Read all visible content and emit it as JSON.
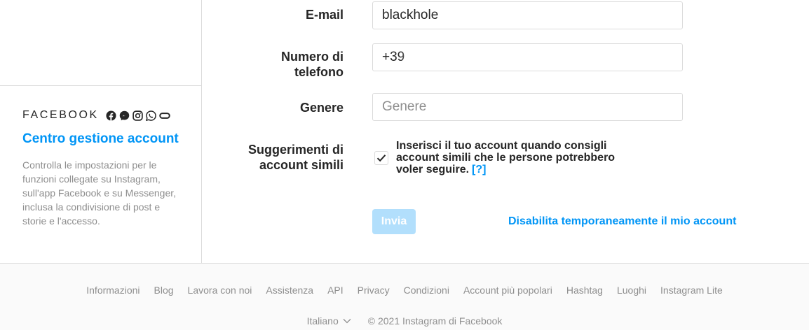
{
  "sidebar": {
    "facebook_wordmark": "FACEBOOK",
    "brand_icons": [
      "facebook-icon",
      "messenger-icon",
      "instagram-icon",
      "whatsapp-icon",
      "oculus-icon"
    ],
    "accounts_center_title": "Centro gestione account",
    "accounts_center_description": "Controlla le impostazioni per le funzioni collegate su Instagram, sull'app Facebook e su Messenger, inclusa la condivisione di post e storie e l'accesso."
  },
  "form": {
    "email": {
      "label": "E-mail",
      "value": "blackhole"
    },
    "phone": {
      "label_line1": "Numero di",
      "label_line2": "telefono",
      "value": "+39"
    },
    "gender": {
      "label": "Genere",
      "placeholder": "Genere",
      "value": ""
    },
    "suggestions": {
      "label_line1": "Suggerimenti di",
      "label_line2": "account simili",
      "checked": true,
      "text": "Inserisci il tuo account quando consigli account simili che le persone potrebbero voler seguire.",
      "help_link": "[?]"
    },
    "submit_label": "Invia",
    "disable_account_link": "Disabilita temporaneamente il mio account"
  },
  "footer": {
    "links": [
      "Informazioni",
      "Blog",
      "Lavora con noi",
      "Assistenza",
      "API",
      "Privacy",
      "Condizioni",
      "Account più popolari",
      "Hashtag",
      "Luoghi",
      "Instagram Lite"
    ],
    "language": "Italiano",
    "copyright": "© 2021 Instagram di Facebook"
  },
  "colors": {
    "accent": "#0095f6",
    "button_disabled": "#b2dffc",
    "border": "#dbdbdb",
    "muted_text": "#8e8e8e",
    "footer_bg": "#fafafa"
  }
}
